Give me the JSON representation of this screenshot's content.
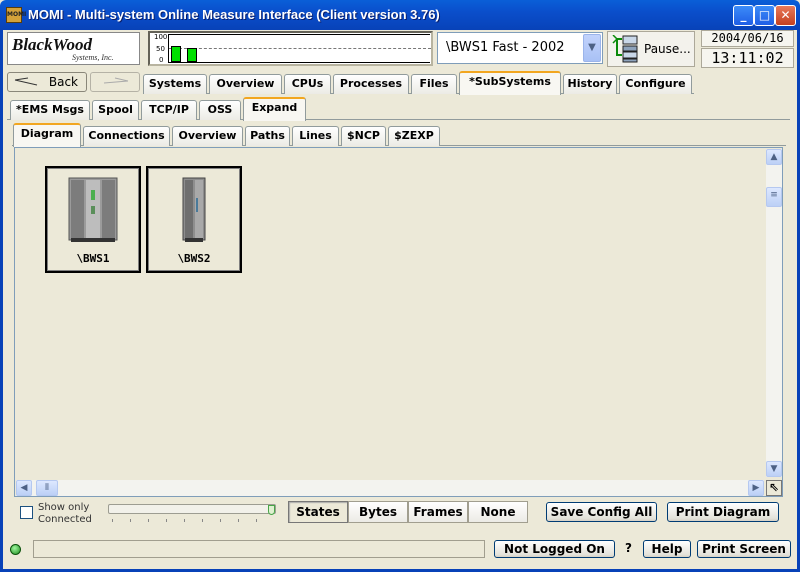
{
  "window": {
    "title": "MOMI - Multi-system Online Measure Interface (Client version 3.76)",
    "app_icon_text": "MOMI"
  },
  "logo": {
    "line1": "BlackWood",
    "line2": "Systems, Inc."
  },
  "gauge": {
    "ticks": [
      "100",
      "50",
      "0"
    ],
    "bars": [
      0.6,
      0.5
    ]
  },
  "system_selector": {
    "value": "\\BWS1 Fast - 2002"
  },
  "pause_label": "Pause...",
  "date": "2004/06/16",
  "time": "13:11:02",
  "nav": {
    "back_label": "Back"
  },
  "main_tabs": [
    "Systems",
    "Overview",
    "CPUs",
    "Processes",
    "Files",
    "*SubSystems",
    "History",
    "Configure"
  ],
  "main_tab_active": "*SubSystems",
  "sub_tabs": [
    "*EMS Msgs",
    "Spool",
    "TCP/IP",
    "OSS",
    "Expand"
  ],
  "sub_tab_active": "Expand",
  "view_tabs": [
    "Diagram",
    "Connections",
    "Overview",
    "Paths",
    "Lines",
    "$NCP",
    "$ZEXP"
  ],
  "view_tab_active": "Diagram",
  "nodes": [
    {
      "label": "\\BWS1",
      "icon": "server-cabinet-icon"
    },
    {
      "label": "\\BWS2",
      "icon": "server-tower-icon"
    }
  ],
  "show_only": {
    "label": "Show only Connected",
    "checked": false
  },
  "display_modes": [
    "States",
    "Bytes",
    "Frames",
    "None"
  ],
  "display_mode_active": "States",
  "buttons": {
    "save_config": "Save Config All",
    "print_diagram": "Print Diagram",
    "not_logged_on": "Not Logged On",
    "help_q": "?",
    "help": "Help",
    "print_screen": "Print Screen"
  }
}
